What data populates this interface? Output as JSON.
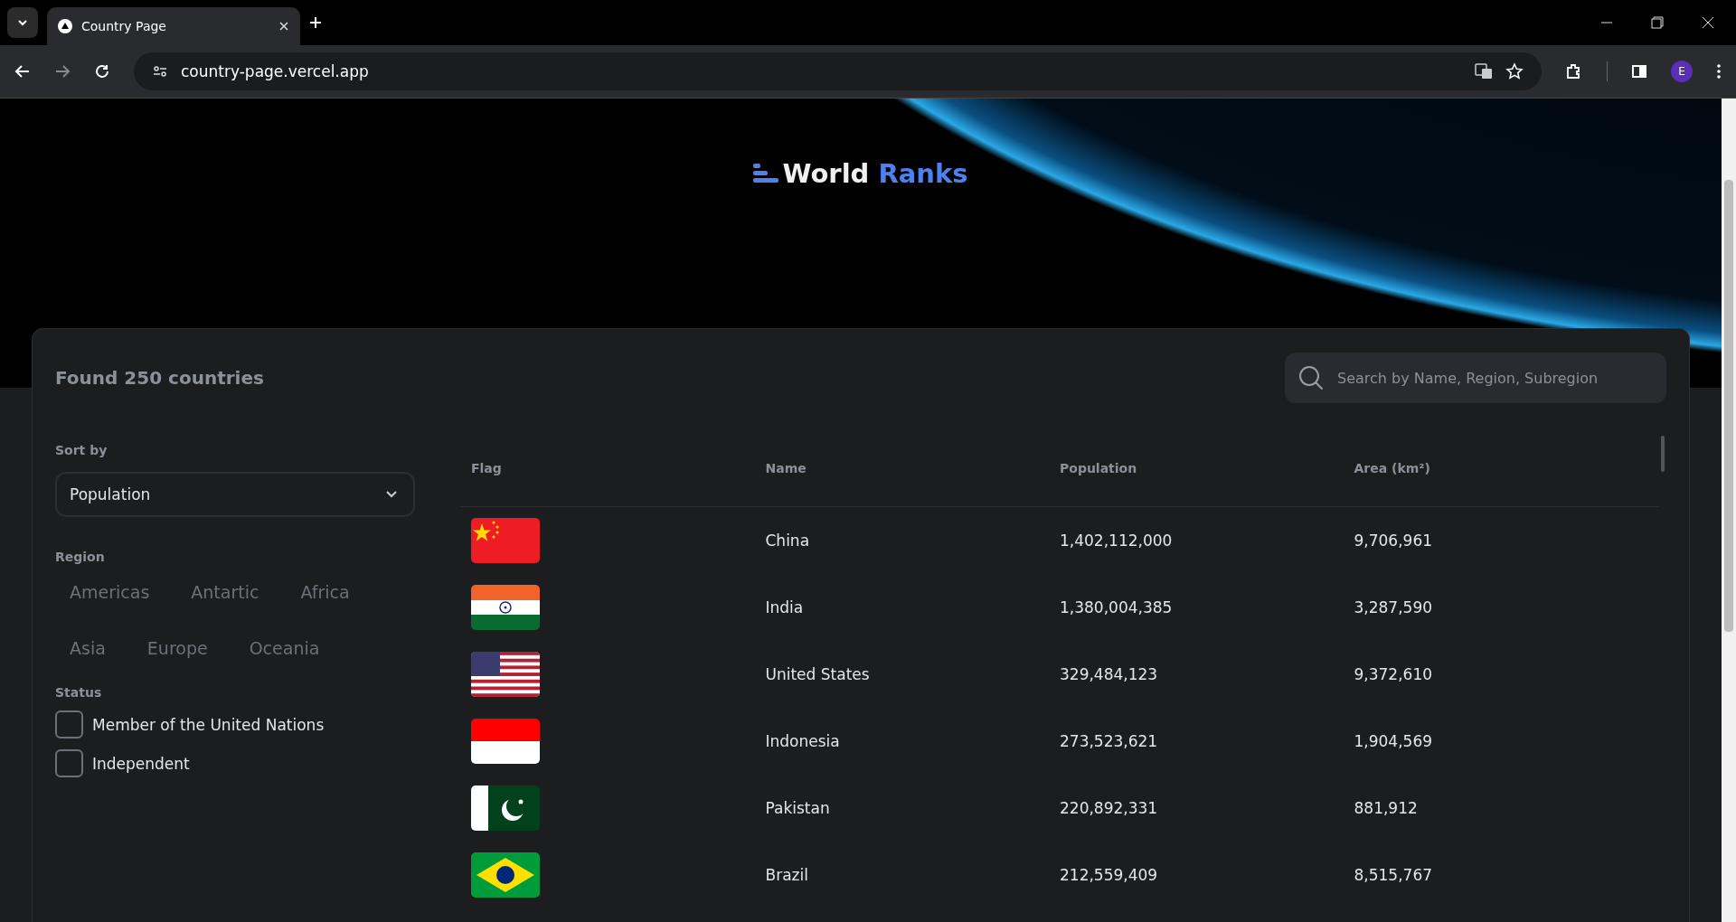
{
  "browser": {
    "tab_title": "Country Page",
    "url": "country-page.vercel.app",
    "profile_initial": "E"
  },
  "header": {
    "logo_text": "World",
    "logo_accent": "Ranks"
  },
  "summary": "Found 250 countries",
  "search": {
    "placeholder": "Search by Name, Region, Subregion"
  },
  "sort": {
    "label": "Sort by",
    "value": "Population"
  },
  "region": {
    "label": "Region",
    "options": [
      {
        "label": "Americas",
        "selected": false
      },
      {
        "label": "Antartic",
        "selected": false
      },
      {
        "label": "Africa",
        "selected": false
      },
      {
        "label": "Asia",
        "selected": false
      },
      {
        "label": "Europe",
        "selected": false
      },
      {
        "label": "Oceania",
        "selected": false
      }
    ]
  },
  "status": {
    "label": "Status",
    "options": [
      {
        "label": "Member of the United Nations",
        "checked": false
      },
      {
        "label": "Independent",
        "checked": false
      }
    ]
  },
  "table": {
    "columns": [
      "Flag",
      "Name",
      "Population",
      "Area (km²)"
    ],
    "rows": [
      {
        "kind": "china",
        "name": "China",
        "population": "1,402,112,000",
        "area": "9,706,961"
      },
      {
        "kind": "india",
        "name": "India",
        "population": "1,380,004,385",
        "area": "3,287,590"
      },
      {
        "kind": "usa",
        "name": "United States",
        "population": "329,484,123",
        "area": "9,372,610"
      },
      {
        "kind": "indonesia",
        "name": "Indonesia",
        "population": "273,523,621",
        "area": "1,904,569"
      },
      {
        "kind": "pakistan",
        "name": "Pakistan",
        "population": "220,892,331",
        "area": "881,912"
      },
      {
        "kind": "brazil",
        "name": "Brazil",
        "population": "212,559,409",
        "area": "8,515,767"
      }
    ]
  }
}
